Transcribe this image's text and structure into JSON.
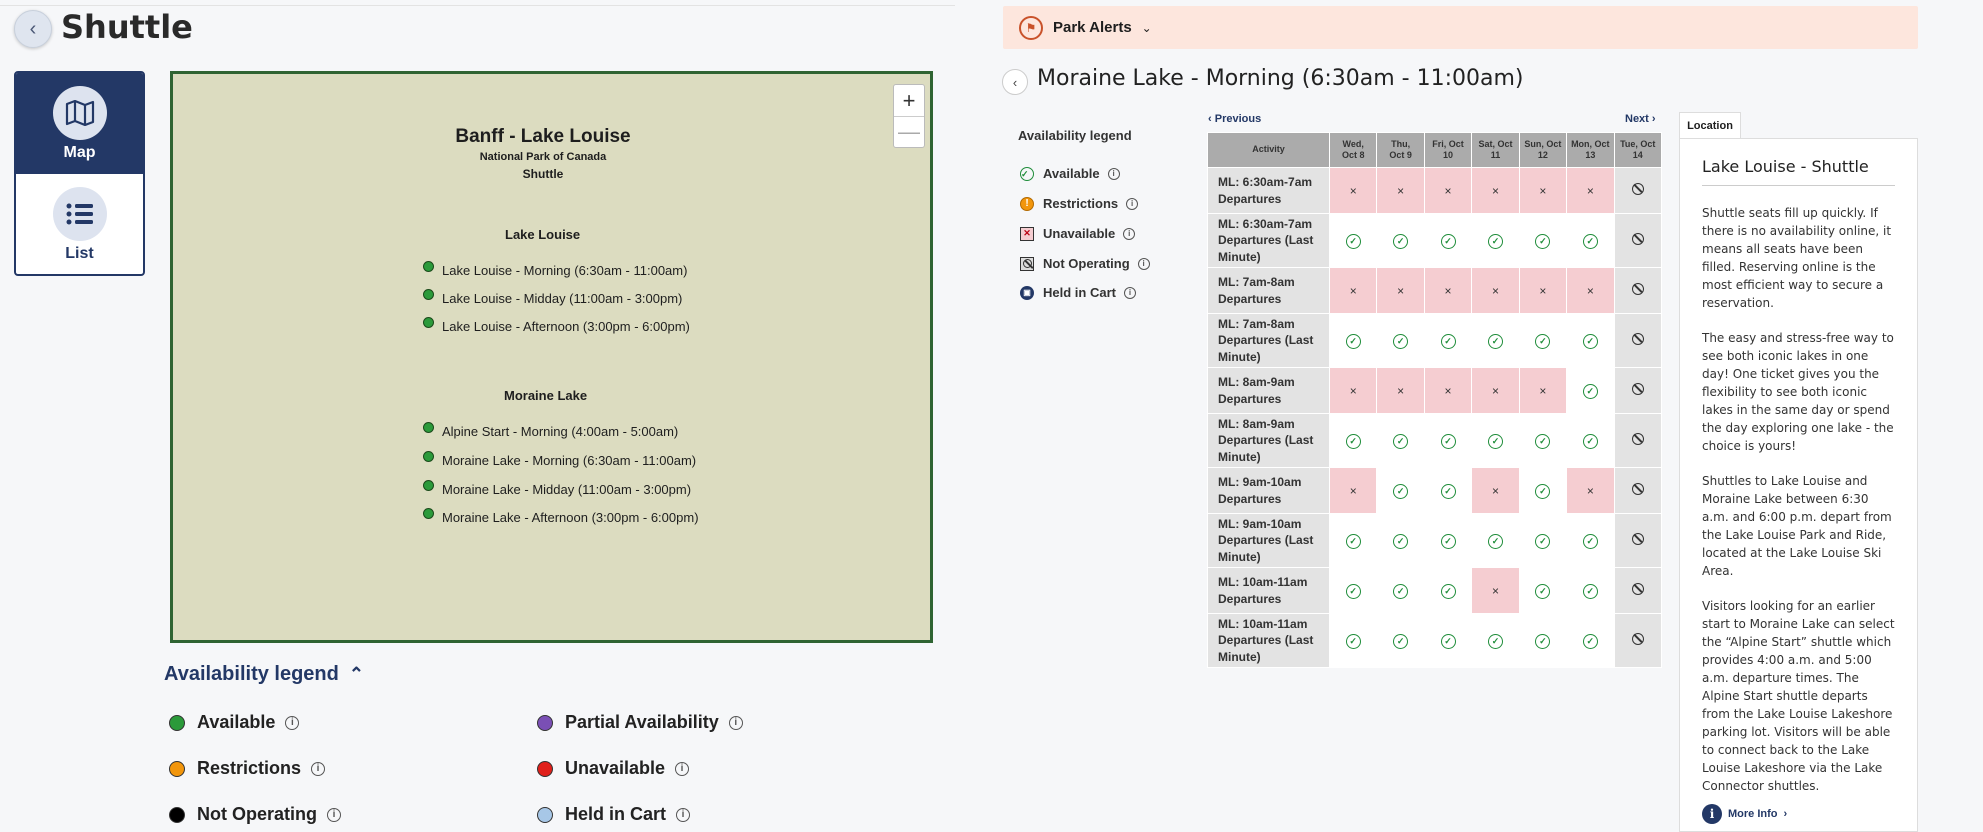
{
  "header": {
    "title": "Shuttle"
  },
  "view_toggle": {
    "map_label": "Map",
    "list_label": "List"
  },
  "map": {
    "title": "Banff - Lake Louise",
    "subtitle": "National Park of Canada",
    "subtitle2": "Shuttle",
    "zoom_in": "+",
    "zoom_out": "—",
    "sections": [
      {
        "name": "Lake Louise",
        "items": [
          "Lake Louise - Morning (6:30am - 11:00am)",
          "Lake Louise - Midday (11:00am - 3:00pm)",
          "Lake Louise - Afternoon (3:00pm - 6:00pm)"
        ]
      },
      {
        "name": "Moraine Lake",
        "items": [
          "Alpine Start - Morning (4:00am - 5:00am)",
          "Moraine Lake - Morning (6:30am - 11:00am)",
          "Moraine Lake - Midday (11:00am - 3:00pm)",
          "Moraine Lake - Afternoon (3:00pm - 6:00pm)"
        ]
      }
    ]
  },
  "bottom_legend": {
    "title": "Availability legend",
    "items": [
      {
        "label": "Available",
        "color": "#2b9a3a"
      },
      {
        "label": "Partial Availability",
        "color": "#7a4fb5"
      },
      {
        "label": "Restrictions",
        "color": "#f2960c"
      },
      {
        "label": "Unavailable",
        "color": "#e0201b"
      },
      {
        "label": "Not Operating",
        "color": "#000000"
      },
      {
        "label": "Held in Cart",
        "color": "#a7c7e7"
      }
    ]
  },
  "alerts": {
    "label": "Park Alerts"
  },
  "detail": {
    "title": "Moraine Lake - Morning (6:30am - 11:00am)"
  },
  "side_legend": {
    "title": "Availability legend",
    "items": [
      "Available",
      "Restrictions",
      "Unavailable",
      "Not Operating",
      "Held in Cart"
    ]
  },
  "grid": {
    "prev": "Previous",
    "next": "Next",
    "activity_header": "Activity",
    "columns": [
      [
        "Wed,",
        "Oct 8"
      ],
      [
        "Thu,",
        "Oct 9"
      ],
      [
        "Fri, Oct",
        "10"
      ],
      [
        "Sat, Oct",
        "11"
      ],
      [
        "Sun, Oct",
        "12"
      ],
      [
        "Mon, Oct",
        "13"
      ],
      [
        "Tue, Oct",
        "14"
      ]
    ],
    "rows": [
      {
        "label": "ML: 6:30am-7am Departures",
        "cells": [
          "U",
          "U",
          "U",
          "U",
          "U",
          "U",
          "N"
        ]
      },
      {
        "label": "ML: 6:30am-7am Departures (Last Minute)",
        "cells": [
          "A",
          "A",
          "A",
          "A",
          "A",
          "A",
          "N"
        ]
      },
      {
        "label": "ML: 7am-8am Departures",
        "cells": [
          "U",
          "U",
          "U",
          "U",
          "U",
          "U",
          "N"
        ]
      },
      {
        "label": "ML: 7am-8am Departures (Last Minute)",
        "cells": [
          "A",
          "A",
          "A",
          "A",
          "A",
          "A",
          "N"
        ]
      },
      {
        "label": "ML: 8am-9am Departures",
        "cells": [
          "U",
          "U",
          "U",
          "U",
          "U",
          "A",
          "N"
        ]
      },
      {
        "label": "ML: 8am-9am Departures (Last Minute)",
        "cells": [
          "A",
          "A",
          "A",
          "A",
          "A",
          "A",
          "N"
        ]
      },
      {
        "label": "ML: 9am-10am Departures",
        "cells": [
          "U",
          "A",
          "A",
          "U",
          "A",
          "U",
          "N"
        ]
      },
      {
        "label": "ML: 9am-10am Departures (Last Minute)",
        "cells": [
          "A",
          "A",
          "A",
          "A",
          "A",
          "A",
          "N"
        ]
      },
      {
        "label": "ML: 10am-11am Departures",
        "cells": [
          "A",
          "A",
          "A",
          "U",
          "A",
          "A",
          "N"
        ]
      },
      {
        "label": "ML: 10am-11am Departures (Last Minute)",
        "cells": [
          "A",
          "A",
          "A",
          "A",
          "A",
          "A",
          "N"
        ]
      }
    ]
  },
  "location": {
    "tab": "Location",
    "title": "Lake Louise - Shuttle",
    "paragraphs": [
      "Shuttle seats fill up quickly. If there is no availability online, it means all seats have been filled. Reserving online is the most efficient way to secure a reservation.",
      "The easy and stress-free way to see both iconic lakes in one day! One ticket gives you the flexibility to see both iconic lakes in the same day or spend the day exploring one lake - the choice is yours!",
      "Shuttles to Lake Louise and Moraine Lake between 6:30 a.m. and 6:00 p.m. depart from the Lake Louise Park and Ride, located at the Lake Louise Ski Area.",
      "Visitors looking for an earlier start to Moraine Lake can select the “Alpine Start” shuttle which provides 4:00 a.m. and 5:00 a.m. departure times. The Alpine Start shuttle departs from the Lake Louise Lakeshore parking lot. Visitors will be able to connect back to the Lake Louise Lakeshore via the Lake Connector shuttles."
    ],
    "more_info": "More Info"
  }
}
